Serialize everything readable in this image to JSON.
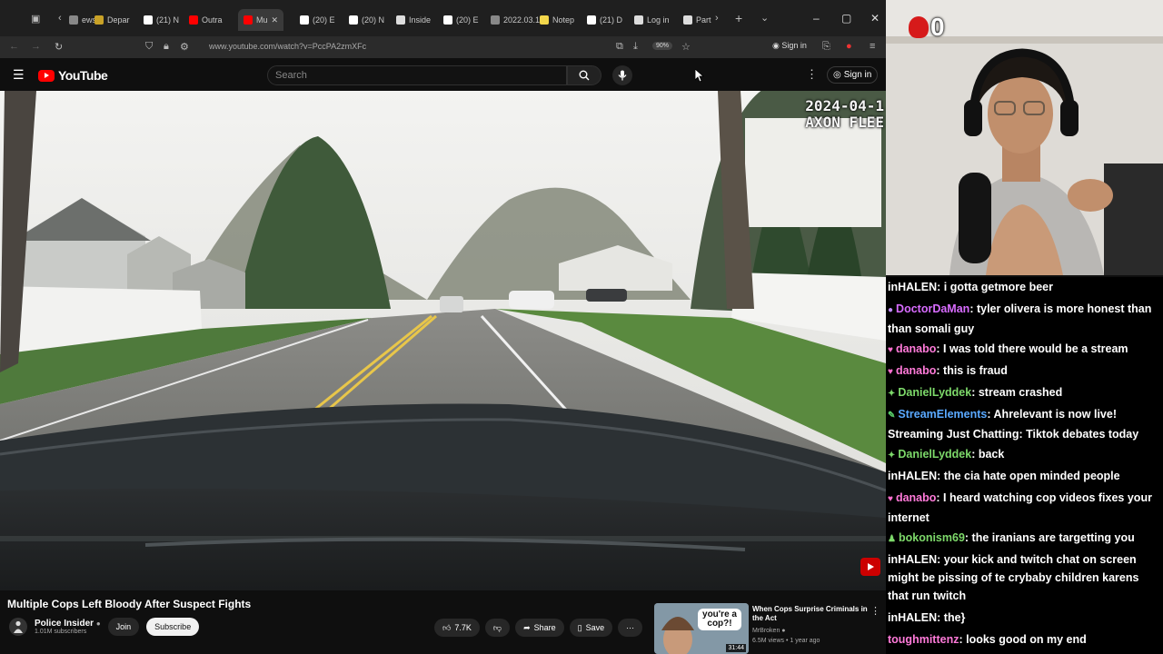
{
  "browser": {
    "tabs": [
      {
        "label": "ews",
        "color": "#888"
      },
      {
        "label": "Depar",
        "color": "#c9a227"
      },
      {
        "label": "(21) N",
        "color": "#fff"
      },
      {
        "label": "Outra",
        "color": "#ff0000"
      },
      {
        "label": "Mu",
        "color": "#ff0000",
        "active": true
      },
      {
        "label": "(20) E",
        "color": "#fff"
      },
      {
        "label": "(20) N",
        "color": "#fff"
      },
      {
        "label": "Inside",
        "color": "#ddd"
      },
      {
        "label": "(20) E",
        "color": "#fff"
      },
      {
        "label": "2022.03.1",
        "color": "#888"
      },
      {
        "label": "Notep",
        "color": "#f2d64b"
      },
      {
        "label": "(21) D",
        "color": "#fff"
      },
      {
        "label": "Log in",
        "color": "#ddd"
      },
      {
        "label": "Part",
        "color": "#ddd"
      }
    ],
    "url": "www.youtube.com/watch?v=PccPA2zmXFc",
    "zoom": "90%",
    "sign_in": "Sign in"
  },
  "youtube": {
    "logo_text": "YouTube",
    "search_placeholder": "Search",
    "sign_in": "Sign in"
  },
  "video": {
    "overlay_date": "2024-04-1",
    "overlay_device": "AXON FLEE",
    "title": "Multiple Cops Left Bloody After Suspect Fights",
    "channel": "Police Insider",
    "subscribers": "1.01M subscribers",
    "join_label": "Join",
    "subscribe_label": "Subscribe",
    "likes": "7.7K",
    "share_label": "Share",
    "save_label": "Save"
  },
  "recommended": {
    "title": "When Cops Surprise Criminals in the Act",
    "channel": "MrBroken",
    "meta": "6.5M views • 1 year ago",
    "duration": "31:44",
    "thumb_text": "you're a cop?!"
  },
  "stream": {
    "counter": "0"
  },
  "chat": [
    {
      "user": "inHALEN",
      "color": "#ffffff",
      "badge": "none",
      "text": ": i gotta getmore beer",
      "lines": 1
    },
    {
      "user": "DoctorDaMan",
      "color": "#d86cff",
      "badge": "dot",
      "text": ": tyler olivera is more honest than than somali guy",
      "lines": 2
    },
    {
      "user": "danabo",
      "color": "#ff7ad9",
      "badge": "heart-tv",
      "text": ": I was told there would be a stream",
      "lines": 1
    },
    {
      "user": "danabo",
      "color": "#ff7ad9",
      "badge": "heart-tv",
      "text": ": this is fraud",
      "lines": 1
    },
    {
      "user": "DanielLyddek",
      "color": "#7dd96a",
      "badge": "star",
      "text": ": stream crashed",
      "lines": 1
    },
    {
      "user": "StreamElements",
      "color": "#5aa9ff",
      "badge": "mod-tv",
      "text": ": Ahrelevant is now live! Streaming Just Chatting: Tiktok debates today",
      "lines": 2
    },
    {
      "user": "DanielLyddek",
      "color": "#7dd96a",
      "badge": "star",
      "text": ": back",
      "lines": 1
    },
    {
      "user": "inHALEN",
      "color": "#ffffff",
      "badge": "none",
      "text": ": the cia hate open minded people",
      "lines": 1
    },
    {
      "user": "danabo",
      "color": "#ff7ad9",
      "badge": "heart-tv",
      "text": ": I heard watching cop videos fixes your internet",
      "lines": 2
    },
    {
      "user": "bokonism69",
      "color": "#7dd96a",
      "badge": "person",
      "text": ": the iranians are targetting you",
      "lines": 1
    },
    {
      "user": "inHALEN",
      "color": "#ffffff",
      "badge": "none",
      "text": ": your kick and twitch chat on screen might be pissing of te crybaby children karens that run twitch",
      "lines": 3
    },
    {
      "user": "inHALEN",
      "color": "#ffffff",
      "badge": "none",
      "text": ": the}",
      "lines": 1
    },
    {
      "user": "toughmittenz",
      "color": "#ff7ad9",
      "badge": "none",
      "text": ": looks good on my end",
      "lines": 1
    }
  ]
}
